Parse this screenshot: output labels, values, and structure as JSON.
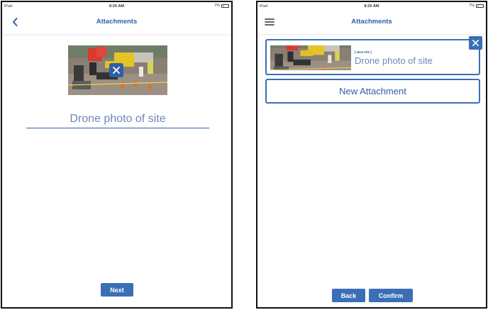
{
  "status_bar": {
    "device": "iPad",
    "time": "8:20 AM",
    "battery": "7%"
  },
  "left_screen": {
    "title": "Attachments",
    "back_icon": "chevron-left-icon",
    "photo_alt_icon": "photo-thumbnail",
    "remove_icon": "close-icon",
    "caption_value": "Drone photo of site",
    "next_label": "Next"
  },
  "right_screen": {
    "title": "Attachments",
    "menu_icon": "hamburger-menu-icon",
    "attachment": {
      "tag": "[ New File ]",
      "name": "Drone photo of site",
      "remove_icon": "close-icon"
    },
    "new_attachment_label": "New Attachment",
    "back_label": "Back",
    "confirm_label": "Confirm"
  },
  "colors": {
    "accent": "#3a6fb5",
    "title": "#2f5fa4",
    "caption_text": "#6f88b6"
  }
}
